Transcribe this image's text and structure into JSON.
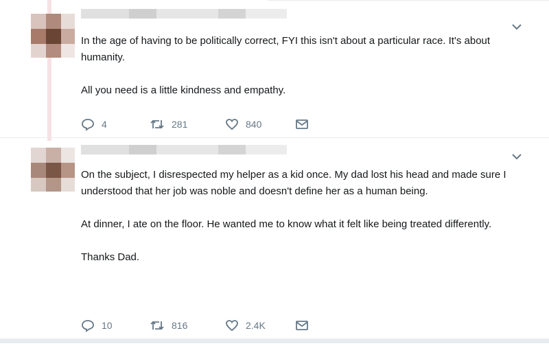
{
  "tweets": [
    {
      "paragraphs": [
        "In the age of having to be politically correct, FYI this isn't about a particular race. It's about humanity.",
        "All you need is a little kindness and empathy."
      ],
      "actions": {
        "replies": "4",
        "retweets": "281",
        "likes": "840"
      }
    },
    {
      "paragraphs": [
        "On the subject, I disrespected my helper as a kid once. My dad lost his head and made sure I understood that her job was noble and doesn't define her as a human being.",
        "At dinner, I ate on the floor. He wanted me to know what it felt like being treated differently.",
        "Thanks Dad."
      ],
      "actions": {
        "replies": "10",
        "retweets": "816",
        "likes": "2.4K"
      }
    }
  ],
  "icons": {
    "reply": "reply-icon",
    "retweet": "retweet-icon",
    "like": "heart-icon",
    "dm": "envelope-icon",
    "more": "chevron-down-icon"
  },
  "colors": {
    "action_gray": "#657786",
    "text": "#14171a",
    "divider": "#e6ecf0"
  }
}
